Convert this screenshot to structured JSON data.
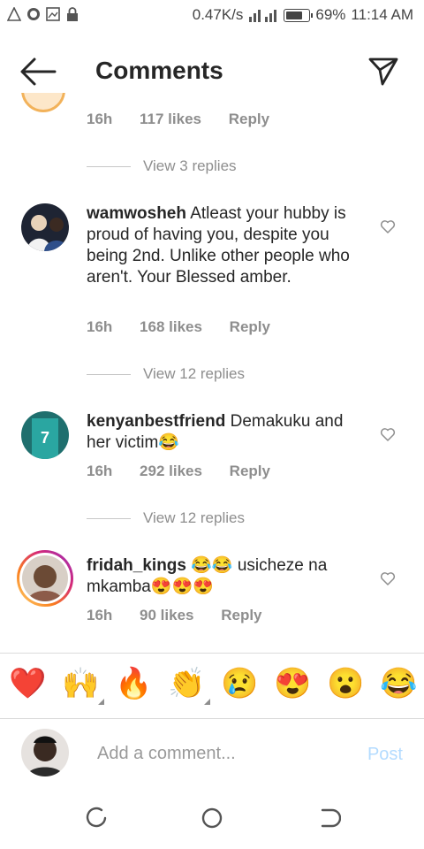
{
  "status_bar": {
    "left_icons": [
      "warning-icon",
      "whatsapp-icon",
      "gallery-icon",
      "lock-icon"
    ],
    "speed": "0.47K/s",
    "battery": "69%",
    "time": "11:14 AM"
  },
  "header": {
    "title": "Comments"
  },
  "partial_comment": {
    "time": "16h",
    "likes": "117 likes",
    "reply": "Reply",
    "view_replies": "View 3 replies"
  },
  "comments": [
    {
      "username": "wamwosheh",
      "text": "Atleast your hubby is proud of having you, despite you being 2nd. Unlike other people who aren't. Your Blessed amber.",
      "time": "16h",
      "likes": "168 likes",
      "reply": "Reply",
      "view_replies": "View 12 replies"
    },
    {
      "username": "kenyanbestfriend",
      "text": "Demakuku and her victim😂",
      "time": "16h",
      "likes": "292 likes",
      "reply": "Reply",
      "view_replies": "View 12 replies"
    },
    {
      "username": "fridah_kings",
      "text": "😂😂 usicheze na mkamba😍😍😍",
      "time": "16h",
      "likes": "90 likes",
      "reply": "Reply"
    }
  ],
  "quick_reactions": [
    "❤️",
    "🙌",
    "🔥",
    "👏",
    "😢",
    "😍",
    "😮",
    "😂"
  ],
  "composer": {
    "placeholder": "Add a comment...",
    "post_label": "Post"
  },
  "colors": {
    "accent_post_disabled": "#b3dbff",
    "muted_text": "#8e8e8e",
    "story_ring": "#d62976"
  }
}
